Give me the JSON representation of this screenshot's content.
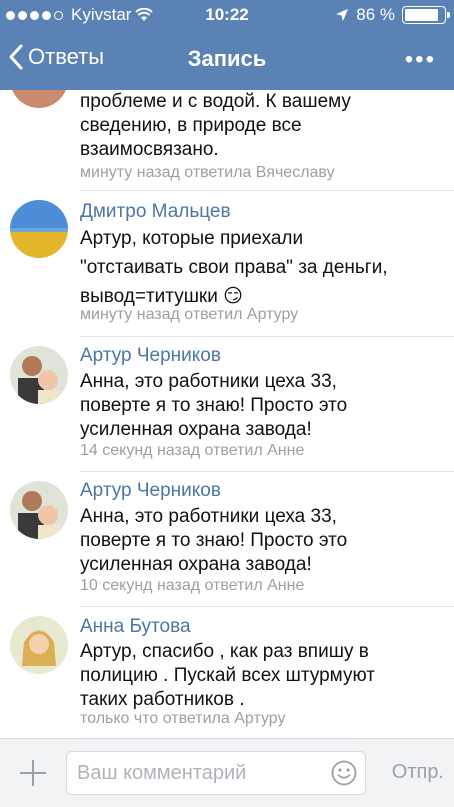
{
  "status_bar": {
    "carrier": "Kyivstar",
    "time": "10:22",
    "battery": "86 %",
    "battery_level": 0.86
  },
  "nav": {
    "back_label": "Ответы",
    "title": "Запись",
    "more": "•••"
  },
  "comments": [
    {
      "author": "",
      "text": "проблеме и с водой. К вашему\nсведению, в природе все\nвзаимосвязано.",
      "meta": "минуту назад ответила Вячеславу"
    },
    {
      "author": "Дмитро Мальцев",
      "text": "Артур, которые приехали\n\"отстаивать свои права\" за деньги,\nвывод=титушки 😏",
      "meta": "минуту назад ответил Артуру"
    },
    {
      "author": "Артур Черников",
      "text": "Анна, это работники цеха 33,\nповерте  я то знаю! Просто это\nусиленная охрана завода!",
      "meta": "14 секунд назад ответил Анне"
    },
    {
      "author": "Артур Черников",
      "text": "Анна, это работники цеха 33,\nповерте  я то знаю! Просто это\nусиленная охрана завода!",
      "meta": "10 секунд назад ответил Анне"
    },
    {
      "author": "Анна Бутова",
      "text": "Артур, спасибо , как раз впишу в\nполицию . Пускай всех штурмуют\nтаких работников .",
      "meta": "только что ответила Артуру"
    }
  ],
  "composer": {
    "placeholder": "Ваш комментарий",
    "send_label": "Отпр."
  },
  "colors": {
    "nav_bar": "#5b82b4",
    "author_link": "#4b76a8",
    "meta_text": "#9aa0a6"
  }
}
